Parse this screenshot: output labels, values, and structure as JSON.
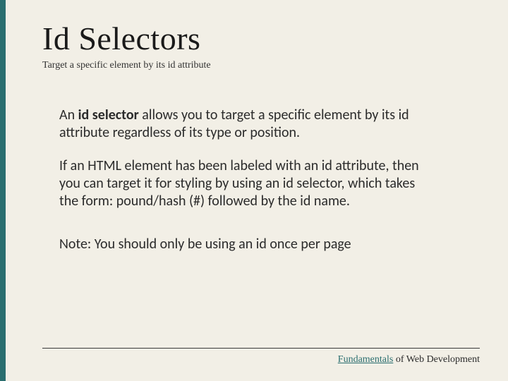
{
  "title": "Id Selectors",
  "subtitle": "Target a specific element by its id attribute",
  "para1_pre": "An ",
  "para1_bold": "id selector",
  "para1_post": " allows you to target a specific element by its id attribute regardless of its type or position.",
  "para2": "If an HTML element has been labeled with an id attribute, then you can target it for styling by using an id selector, which takes the form: pound/hash (#) followed by the id name.",
  "note": "Note: You should only be using an id once per page",
  "footer_word1": "Fundamentals",
  "footer_word2": " of ",
  "footer_word3": "Web Development"
}
